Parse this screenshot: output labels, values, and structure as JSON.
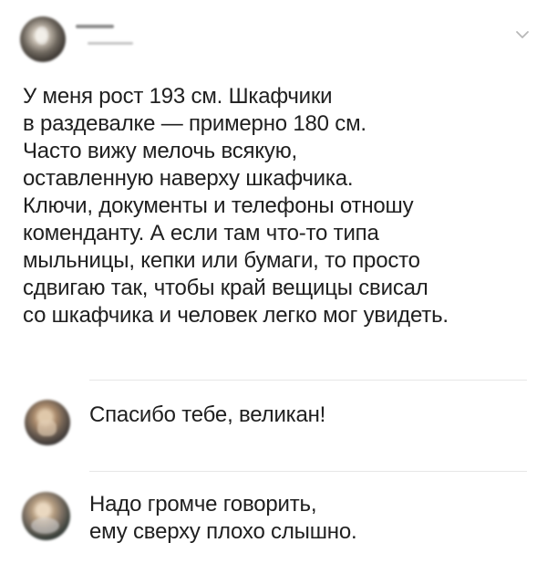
{
  "post": {
    "text": "У меня рост 193 см. Шкафчики\nв раздевалке — примерно 180 см.\nЧасто вижу мелочь всякую,\nоставленную наверху шкафчика.\nКлючи, документы и телефоны отношу\nкоменданту. А если там что-то типа\nмыльницы, кепки или бумаги, то просто\nсдвигаю так, чтобы край вещицы свисал\nсо шкафчика и человек легко мог увидеть."
  },
  "comments": [
    {
      "text": "Спасибо тебе, великан!"
    },
    {
      "text": "Надо громче говорить,\nему сверху плохо слышно."
    }
  ],
  "icons": {
    "menu": "chevron-down-icon"
  },
  "colors": {
    "text": "#202020",
    "divider": "#e7e7e7",
    "chevron": "#b8b8b8"
  }
}
